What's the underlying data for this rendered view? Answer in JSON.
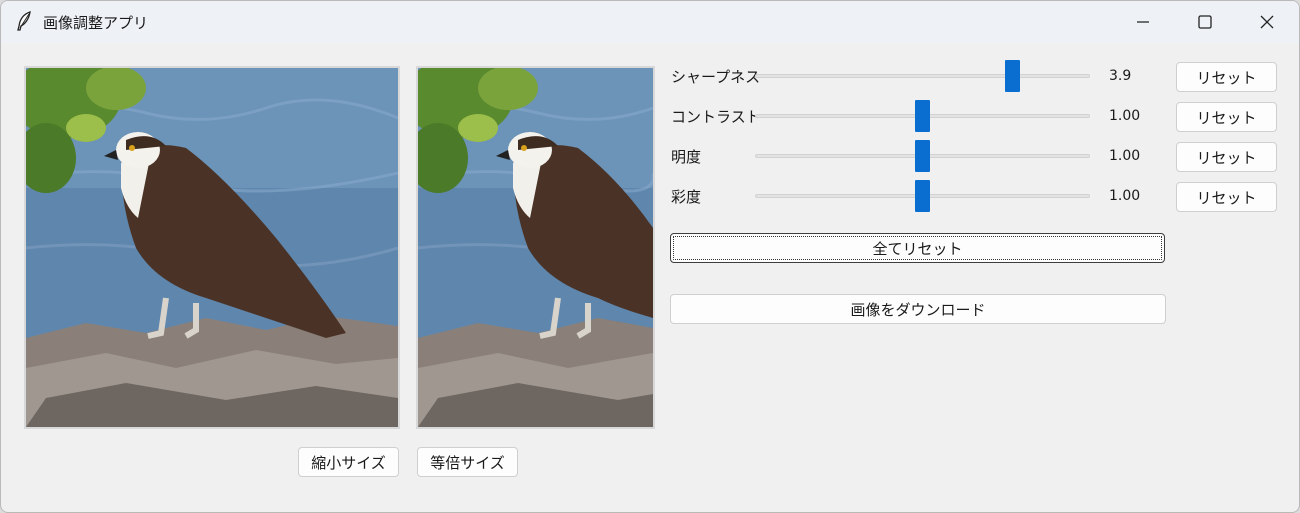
{
  "window": {
    "title": "画像調整アプリ",
    "icon": "feather-icon",
    "controls": [
      "minimize-icon",
      "maximize-icon",
      "close-icon"
    ]
  },
  "images": {
    "original_alt": "",
    "adjusted_alt": ""
  },
  "size_buttons": {
    "shrink": "縮小サイズ",
    "actual": "等倍サイズ"
  },
  "sliders": [
    {
      "label": "シャープネス",
      "value": "3.9",
      "fraction": 0.77,
      "reset": "リセット"
    },
    {
      "label": "コントラスト",
      "value": "1.00",
      "fraction": 0.5,
      "reset": "リセット"
    },
    {
      "label": "明度",
      "value": "1.00",
      "fraction": 0.5,
      "reset": "リセット"
    },
    {
      "label": "彩度",
      "value": "1.00",
      "fraction": 0.5,
      "reset": "リセット"
    }
  ],
  "actions": {
    "reset_all": "全てリセット",
    "download": "画像をダウンロード"
  },
  "colors": {
    "accent": "#0a6ed1",
    "window_bg": "#f0f0f0",
    "titlebar_bg": "#eef1f6"
  }
}
